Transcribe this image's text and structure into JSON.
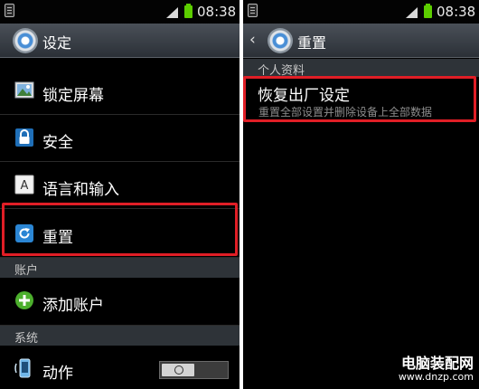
{
  "status_bar": {
    "time": "08:38"
  },
  "left": {
    "title": "设定",
    "items": [
      {
        "label": "锁定屏幕",
        "icon": "landscape-photo-icon"
      },
      {
        "label": "安全",
        "icon": "padlock-icon"
      },
      {
        "label": "语言和输入",
        "icon": "letter-a-icon"
      },
      {
        "label": "重置",
        "icon": "reset-arrow-icon"
      }
    ],
    "section_accounts": "账户",
    "add_account_label": "添加账户",
    "section_system": "系统",
    "motion_label": "动作"
  },
  "right": {
    "title": "重置",
    "section_personal": "个人资料",
    "factory_reset_title": "恢复出厂设定",
    "factory_reset_subtitle": "重置全部设置并删除设备上全部数据"
  },
  "watermark": {
    "name": "电脑装配网",
    "url": "www.dnzp.com"
  },
  "colors": {
    "highlight": "#e01e26",
    "titlebar": "#3a4047",
    "section": "#2e3338",
    "battery": "#5ccd00"
  }
}
